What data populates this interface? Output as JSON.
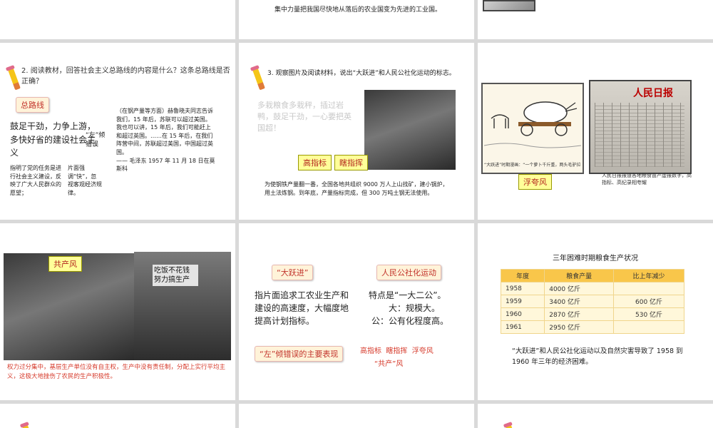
{
  "s2": {
    "text": "集中力量把我国尽快地从落后的农业国变为先进的工业国。"
  },
  "s4": {
    "question": "2. 阅读教材，回答社会主义总路线的内容是什么？这条总路线是否正确？",
    "tag": "总路线",
    "slogan": "鼓足干劲，力争上游，多快好省的建设社会主义",
    "error_label": "“左”倾错误",
    "note_left": "指明了党的任务是进行社会主义建设，反映了广大人民群众的愿望；",
    "note_right": "片面强调“快”，忽视客观经济规律。",
    "quote": "（在钢产量等方面）赫鲁晓夫同志告诉我们，15 年后，苏联可以超过美国。我也可以讲，15 年后，我们可能赶上和超过英国。……在 15 年后，在我们阵营中间，苏联超过美国，中国超过英国。",
    "quote_src": "—— 毛泽东 1957 年 11 月 18 日在莫斯科"
  },
  "s5": {
    "question": "3. 观察图片及阅读材料，说出“大跃进”和人民公社化运动的标志。",
    "slogan": "多栽粮食多栽秤，插过岩鸭，鼓足干劲，一心要把英国超！",
    "tag1": "高指标",
    "tag2": "瞎指挥",
    "caption": "为使钢铁产量翻一番，全国各地共组织 9000 万人上山找矿，建小锅炉，用土法炼钢。到年底，产量指标完成，但 300 万吨土钢无法使用。"
  },
  "s6": {
    "cartoon_caption": "“大跃进”时期漫画：“一个萝卜千斤重，两头毛驴拉不动。”",
    "paper_title": "人民日报",
    "tag": "浮夸风",
    "caption": "人民日报报道各地粮食亩产虚报数字，高指标、高纪录相夸耀"
  },
  "s7": {
    "tag": "共产风",
    "banner": "吃饭不花钱 努力搞生产",
    "caption": "权力过分集中，基层生产单位没有自主权，生产中没有责任制，分配上实行平均主义，这极大地挫伤了农民的生产积极性。"
  },
  "s8": {
    "tag1": "“大跃进”",
    "tag2": "人民公社化运动",
    "left_text": "指片面追求工农业生产和建设的高速度，大幅度地提高计划指标。",
    "right_line1": "特点是“一大二公”。",
    "right_line2": "大：规模大。",
    "right_line3": "公：公有化程度高。",
    "tag3": "“左”倾错误的主要表现",
    "list": [
      "高指标",
      "瞎指挥",
      "浮夸风"
    ],
    "list2": "“共产”风"
  },
  "s9": {
    "title": "三年困难时期粮食生产状况",
    "headers": [
      "年度",
      "粮食产量",
      "比上年减少"
    ],
    "rows": [
      [
        "1958",
        "4000 亿斤",
        ""
      ],
      [
        "1959",
        "3400 亿斤",
        "600 亿斤"
      ],
      [
        "1960",
        "2870 亿斤",
        "530 亿斤"
      ],
      [
        "1961",
        "2950 亿斤",
        ""
      ]
    ],
    "conclusion": "“大跃进”和人民公社化运动以及自然灾害导致了 1958 到 1960 年三年的经济困难。"
  }
}
